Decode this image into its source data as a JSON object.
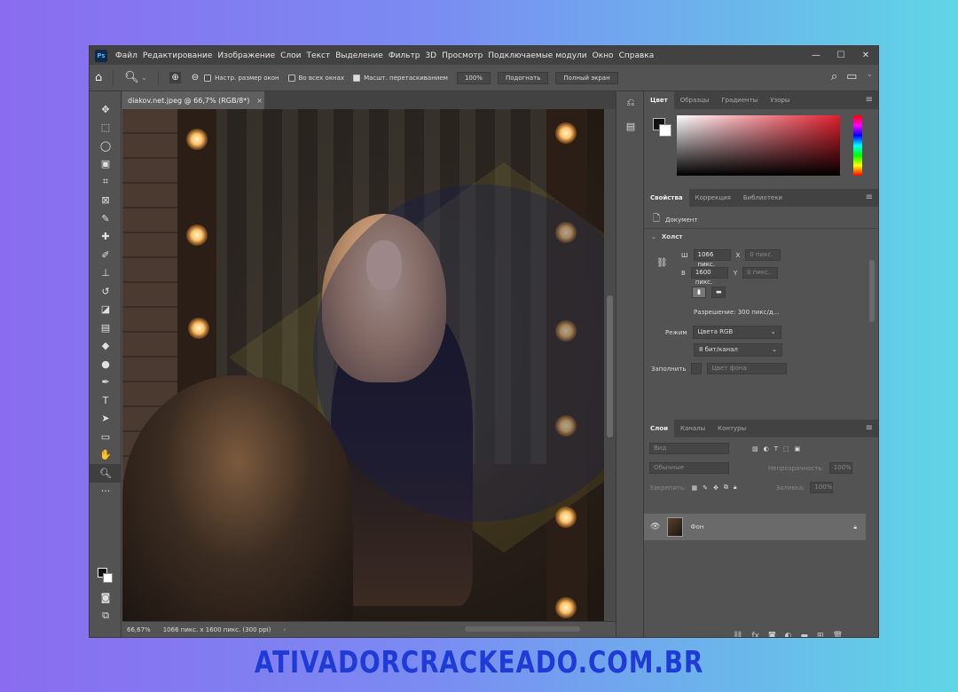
{
  "app": {
    "logo": "Ps",
    "menu": [
      "Файл",
      "Редактирование",
      "Изображение",
      "Слои",
      "Текст",
      "Выделение",
      "Фильтр",
      "3D",
      "Просмотр",
      "Подключаемые модули",
      "Окно",
      "Справка"
    ],
    "window_controls": {
      "minimize": "—",
      "maximize": "☐",
      "close": "✕"
    }
  },
  "options_bar": {
    "resize_windows": "Настр. размер окон",
    "all_windows": "Во всех окнах",
    "scrubby_zoom": "Масшт. перетаскиванием",
    "zoom_value": "100%",
    "fit_button": "Подогнать",
    "fullscreen_button": "Полный экран"
  },
  "document": {
    "tab_title": "diakov.net.jpeg @ 66,7% (RGB/8*)",
    "tab_close": "×",
    "status_zoom": "66,67%",
    "status_info": "1066 пикс. x 1600 пикс. (300 ppi)"
  },
  "color_panel": {
    "tabs": [
      "Цвет",
      "Образцы",
      "Градиенты",
      "Узоры"
    ],
    "foreground": "#111111",
    "background": "#ffffff",
    "picker_hue": "#e01e2e"
  },
  "properties_panel": {
    "tabs": [
      "Свойства",
      "Коррекция",
      "Библиотеки"
    ],
    "doc_label": "Документ",
    "canvas_section": "Холст",
    "w_label": "Ш",
    "w_value": "1066 пикс.",
    "x_label": "X",
    "x_value": "0 пикс.",
    "h_label": "В",
    "h_value": "1600 пикс.",
    "y_label": "Y",
    "y_value": "0 пикс.",
    "resolution": "Разрешение: 300 пикс/д...",
    "mode_label": "Режим",
    "mode_value": "Цвета RGB",
    "depth_value": "8 бит/канал",
    "fill_label": "Заполнить",
    "fill_value": "Цвет фона"
  },
  "layers_panel": {
    "tabs": [
      "Слои",
      "Каналы",
      "Контуры"
    ],
    "search_placeholder": "Вид",
    "blend_mode": "Обычные",
    "opacity_label": "Непрозрачность:",
    "opacity_value": "100%",
    "lock_label": "Закрепить:",
    "fill_label": "Заливка:",
    "fill_value": "100%",
    "layer_name": "Фон"
  },
  "watermark": "ATIVADORCRACKEADO.COM.BR"
}
